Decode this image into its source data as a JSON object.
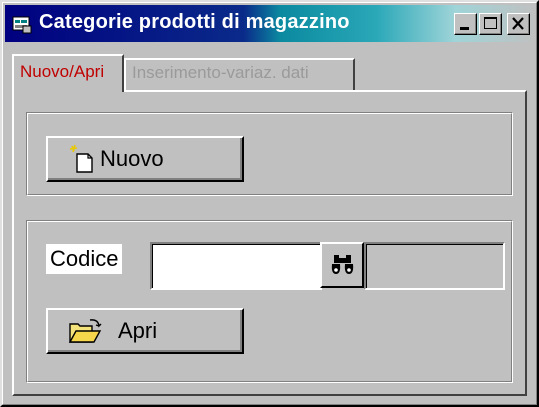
{
  "window": {
    "title": "Categorie prodotti di magazzino",
    "controls": [
      "minimize-icon",
      "maximize-icon",
      "close-icon"
    ]
  },
  "tabs": [
    {
      "label": "Nuovo/Apri",
      "active": true
    },
    {
      "label": "Inserimento-variaz. dati",
      "active": false
    }
  ],
  "new_section": {
    "new_button_label": "Nuovo",
    "new_button_icon": "new-document-icon"
  },
  "open_section": {
    "code_label": "Codice",
    "code_value": "",
    "search_icon": "binoculars-icon",
    "description_value": "",
    "open_button_label": "Apri",
    "open_button_icon": "open-folder-icon"
  },
  "colors": {
    "titlebar_start": "#000080",
    "titlebar_end": "#c0c0c0",
    "active_tab_text": "#c00000",
    "inactive_tab_text": "#9a9a9a",
    "face": "#c0c0c0"
  }
}
